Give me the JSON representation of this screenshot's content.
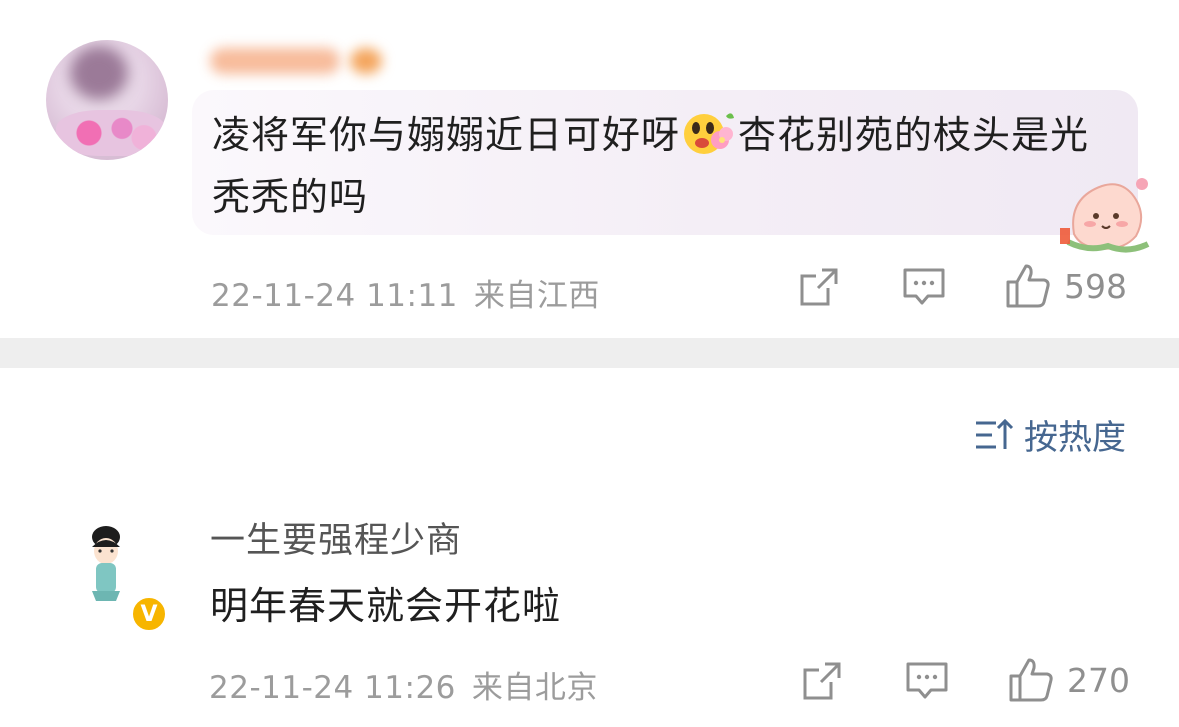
{
  "comments": [
    {
      "text_part1": "凌将军你与嫋嫋近日可好呀",
      "emoji": "flower-face-emoji",
      "text_part2": "杏花别苑的枝头是光秃秃的吗",
      "time": "22-11-24 11:11",
      "source": "来自江西",
      "likes": "598",
      "badge": "peach-character-sticker"
    },
    {
      "username": "一生要强程少商",
      "text": "明年春天就会开花啦",
      "time": "22-11-24 11:26",
      "source": "来自北京",
      "likes": "270",
      "verified_badge": "V"
    }
  ],
  "sort": {
    "label": "按热度",
    "icon": "sort-icon"
  },
  "colors": {
    "meta_gray": "#9c9c9c",
    "sort_blue": "#466790",
    "verified_yellow": "#f7b500"
  }
}
